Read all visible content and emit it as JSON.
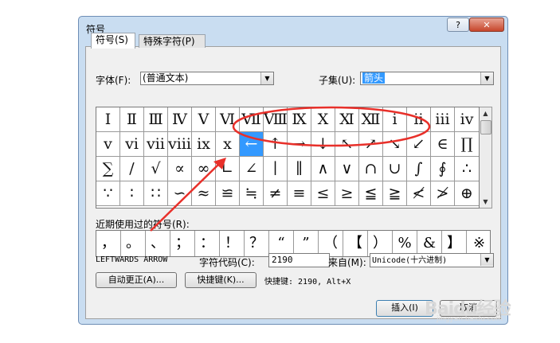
{
  "window": {
    "title": "符号",
    "help_label": "?",
    "close_label": "✕"
  },
  "tabs": [
    {
      "label": "符号(S)"
    },
    {
      "label": "特殊字符(P)"
    }
  ],
  "font": {
    "label": "字体(F):",
    "value": "(普通文本)"
  },
  "subset": {
    "label": "子集(U):",
    "value": "箭头"
  },
  "symbols": [
    [
      "Ⅰ",
      "Ⅱ",
      "Ⅲ",
      "Ⅳ",
      "Ⅴ",
      "Ⅵ",
      "Ⅶ",
      "Ⅷ",
      "Ⅸ",
      "Ⅹ",
      "Ⅺ",
      "Ⅻ",
      "ⅰ",
      "ⅱ",
      "ⅲ",
      "ⅳ"
    ],
    [
      "ⅴ",
      "ⅵ",
      "ⅶ",
      "ⅷ",
      "ⅸ",
      "ⅹ",
      "←",
      "↑",
      "→",
      "↓",
      "↖",
      "↗",
      "↘",
      "↙",
      "∈",
      "∏"
    ],
    [
      "∑",
      "∕",
      "√",
      "∝",
      "∞",
      "∟",
      "∠",
      "∣",
      "∥",
      "∧",
      "∨",
      "∩",
      "∪",
      "∫",
      "∮",
      "∴"
    ],
    [
      "∵",
      "∶",
      "∷",
      "∽",
      "≈",
      "≌",
      "≒",
      "≠",
      "≡",
      "≤",
      "≥",
      "≦",
      "≧",
      "≮",
      "≯",
      "⊕"
    ]
  ],
  "selected_symbol": "←",
  "recent": {
    "label": "近期使用过的符号(R):",
    "symbols": [
      "，",
      "。",
      "、",
      "；",
      "：",
      "！",
      "？",
      "“",
      "”",
      "（",
      "【",
      "）",
      "%",
      "&",
      "】",
      "※"
    ]
  },
  "char_name": "LEFTWARDS ARROW",
  "char_code": {
    "label": "字符代码(C):",
    "value": "2190"
  },
  "from": {
    "label": "来自(M):",
    "value": "Unicode(十六进制)"
  },
  "autocorrect_label": "自动更正(A)...",
  "shortcut_button_label": "快捷键(K)...",
  "shortcut_info": "快捷键: 2190, Alt+X",
  "insert_label": "插入(I)",
  "cancel_label": "取消",
  "watermark": {
    "main": "Baidu经验",
    "sub": "jingyan.baidu.com"
  },
  "colors": {
    "selection": "#3399ff",
    "annotation": "#e8302a"
  }
}
